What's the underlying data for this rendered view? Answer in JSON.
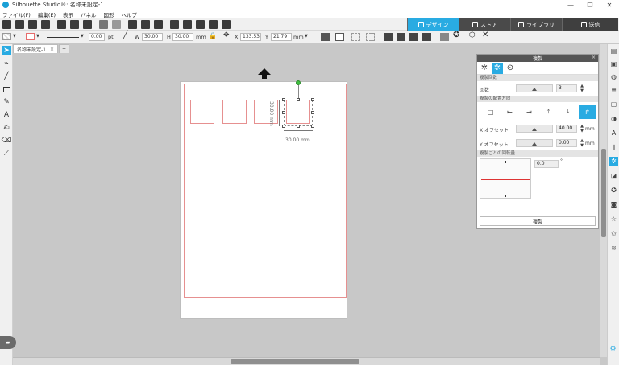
{
  "window": {
    "title": "Silhouette Studio®: 名称未設定-1",
    "minimize": "—",
    "maximize": "❐",
    "close": "✕"
  },
  "menu": [
    "ファイル(F)",
    "編集(E)",
    "表示",
    "パネル",
    "図形",
    "ヘルプ"
  ],
  "tabs": {
    "design": "デザイン",
    "store": "ストア",
    "library": "ライブラリ",
    "send": "送信"
  },
  "toolbar2": {
    "line_width": "0.00",
    "line_unit": "pt",
    "w_label": "W",
    "w_value": "30.00",
    "h_label": "H",
    "h_value": "30.00",
    "size_unit": "mm",
    "x_label": "X",
    "x_value": "133.53",
    "y_label": "Y",
    "y_value": "21.79",
    "pos_unit": "mm",
    "stroke_color": "#e66b6b"
  },
  "document": {
    "tab_name": "名称未設定-1",
    "close": "×",
    "new_tab": "+"
  },
  "canvas": {
    "width_dim": "30.00 mm",
    "height_dim": "30.00 mm"
  },
  "panel": {
    "title": "複製",
    "close": "×",
    "sec_options": "複製回数",
    "count_label": "回数",
    "count_value": "3",
    "sec_direction": "複製の配置方向",
    "x_offset_label": "X オフセット",
    "x_offset_value": "40.00",
    "y_offset_label": "Y オフセット",
    "y_offset_value": "0.00",
    "offset_unit": "mm",
    "sec_rotation": "複製ごとの回転量",
    "rotation_value": "0.0",
    "degree": "°",
    "replicate_button": "複製",
    "spin": "▲▼"
  },
  "colors": {
    "accent": "#29abe2",
    "cut_line": "#e69090"
  }
}
